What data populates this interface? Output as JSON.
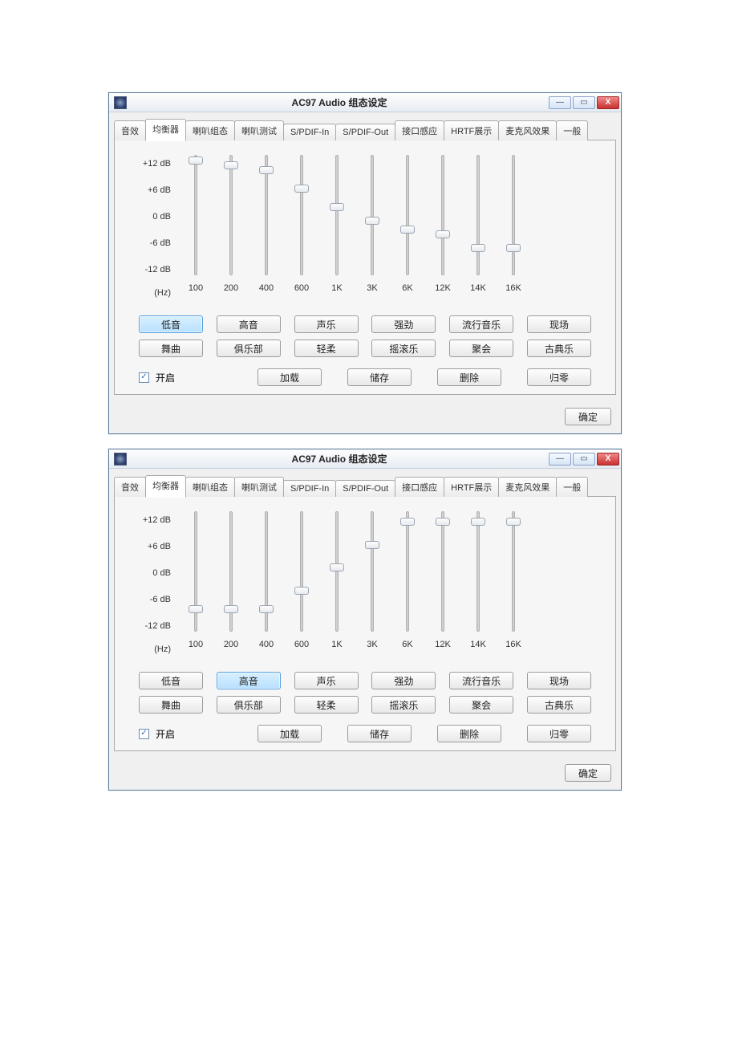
{
  "windows": [
    {
      "title": "AC97 Audio 组态设定",
      "tabs": [
        "音效",
        "均衡器",
        "喇叭组态",
        "喇叭测试",
        "S/PDIF-In",
        "S/PDIF-Out",
        "接口感应",
        "HRTF展示",
        "麦克风效果",
        "一般"
      ],
      "active_tab": "均衡器",
      "db_labels": [
        "+12 dB",
        "+6 dB",
        "0 dB",
        "-6 dB",
        "-12 dB"
      ],
      "hz_label": "(Hz)",
      "freqs": [
        "100",
        "200",
        "400",
        "600",
        "1K",
        "3K",
        "6K",
        "12K",
        "14K",
        "16K"
      ],
      "slider_values": [
        12,
        11,
        10,
        6,
        2,
        -1,
        -3,
        -4,
        -7,
        -7
      ],
      "selected_preset": "低音",
      "presets_row1": [
        "低音",
        "高音",
        "声乐",
        "强劲",
        "流行音乐",
        "现场"
      ],
      "presets_row2": [
        "舞曲",
        "俱乐部",
        "轻柔",
        "摇滚乐",
        "聚会",
        "古典乐"
      ],
      "enable_label": "开启",
      "enable_checked": true,
      "action_buttons": [
        "加载",
        "储存",
        "删除",
        "归零"
      ],
      "ok_label": "确定"
    },
    {
      "title": "AC97 Audio 组态设定",
      "tabs": [
        "音效",
        "均衡器",
        "喇叭组态",
        "喇叭测试",
        "S/PDIF-In",
        "S/PDIF-Out",
        "接口感应",
        "HRTF展示",
        "麦克风效果",
        "一般"
      ],
      "active_tab": "均衡器",
      "db_labels": [
        "+12 dB",
        "+6 dB",
        "0 dB",
        "-6 dB",
        "-12 dB"
      ],
      "hz_label": "(Hz)",
      "freqs": [
        "100",
        "200",
        "400",
        "600",
        "1K",
        "3K",
        "6K",
        "12K",
        "14K",
        "16K"
      ],
      "slider_values": [
        -8,
        -8,
        -8,
        -4,
        1,
        6,
        11,
        11,
        11,
        11
      ],
      "selected_preset": "高音",
      "presets_row1": [
        "低音",
        "高音",
        "声乐",
        "强劲",
        "流行音乐",
        "现场"
      ],
      "presets_row2": [
        "舞曲",
        "俱乐部",
        "轻柔",
        "摇滚乐",
        "聚会",
        "古典乐"
      ],
      "enable_label": "开启",
      "enable_checked": true,
      "action_buttons": [
        "加载",
        "储存",
        "删除",
        "归零"
      ],
      "ok_label": "确定"
    }
  ]
}
